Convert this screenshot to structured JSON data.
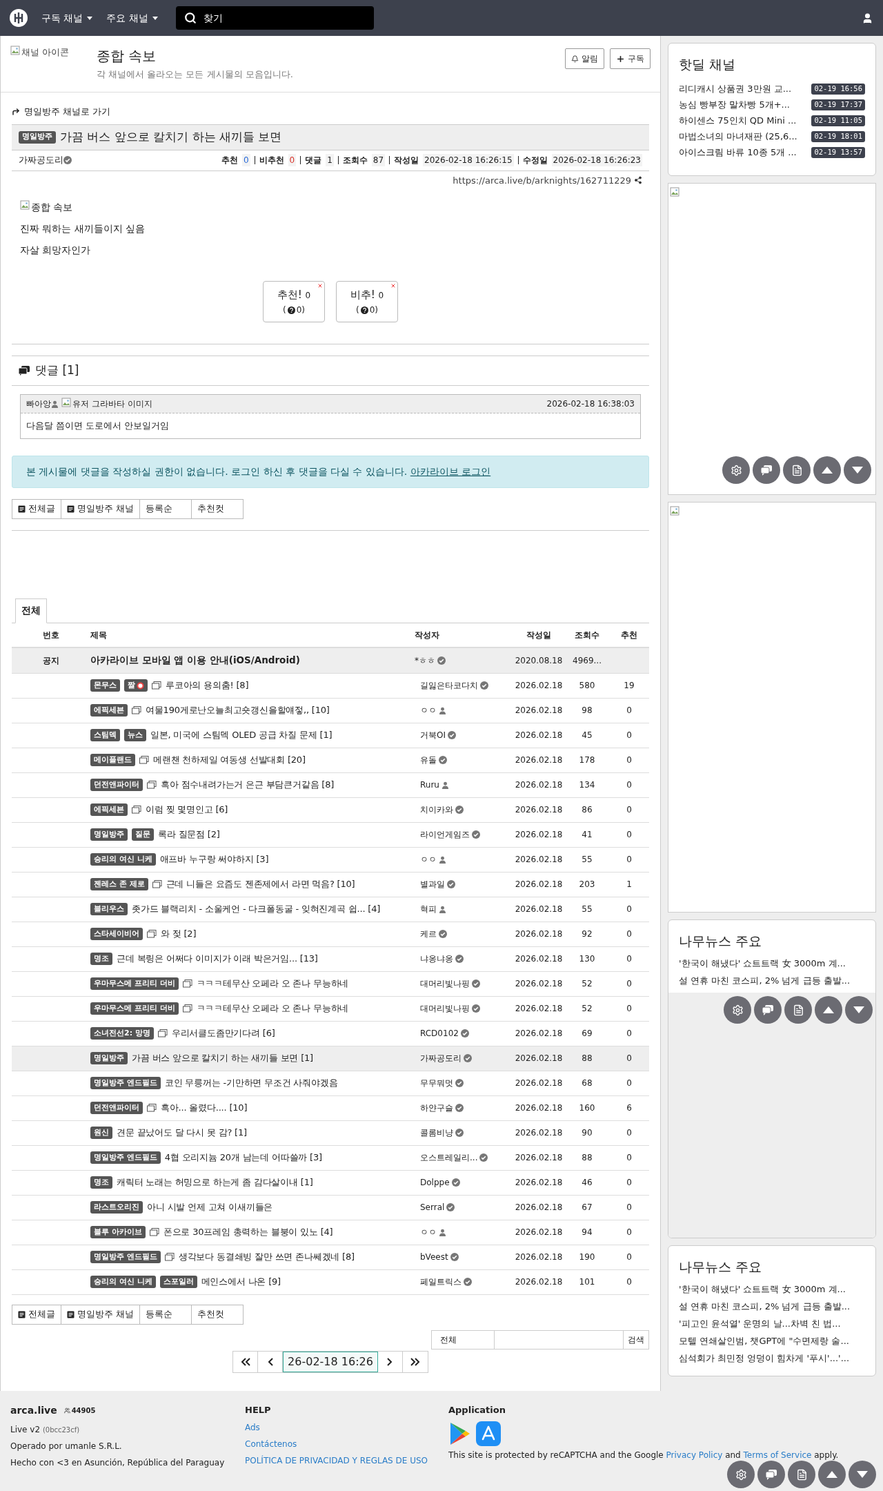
{
  "header": {
    "menus": [
      {
        "label": "구독 채널"
      },
      {
        "label": "주요 채널"
      }
    ],
    "search": {
      "placeholder": "찾기"
    }
  },
  "channel": {
    "icon_alt": "채널 아이콘",
    "title": "종합 속보",
    "description": "각 채널에서 올라오는 모든 게시물의 모음입니다.",
    "buttons": [
      {
        "label": "알림",
        "kind": "bell"
      },
      {
        "label": "구독",
        "kind": "plus"
      }
    ]
  },
  "post": {
    "back_link": "명일방주 채널로 가기",
    "category": "명일방주",
    "title": "가끔 버스 앞으로 칼치기 하는 새끼들 보면",
    "author": "가짜공도리",
    "stats": [
      {
        "label": "추천",
        "value": "0",
        "color": "#2a6bd8"
      },
      {
        "label": "비추천",
        "value": "0",
        "color": "#d9342b"
      },
      {
        "label": "댓글",
        "value": "1",
        "color": "#222222"
      },
      {
        "label": "조회수",
        "value": "87",
        "color": "#222222"
      },
      {
        "label": "작성일",
        "value": "2026-02-18 16:26:15",
        "color": "#222222"
      },
      {
        "label": "수정일",
        "value": "2026-02-18 16:26:23",
        "color": "#222222"
      }
    ],
    "url": "https://arca.live/b/arknights/162711229",
    "image_alt": "종합 속보",
    "body": [
      "진짜 뭐하는 새끼들이지 싶음",
      "자살 희망자인가"
    ],
    "votes": [
      {
        "label": "추천!",
        "count": "0",
        "sub": "0)",
        "open": "("
      },
      {
        "label": "비추!",
        "count": "0",
        "sub": "0)",
        "open": "("
      }
    ]
  },
  "comments": {
    "title": "댓글 [1]",
    "items": [
      {
        "author": "빠아앙",
        "avatar_alt": "유저 그라바타 이미지",
        "time": "2026-02-18 16:38:03",
        "text": "다음달 쯤이면 도로에서 안보일거임"
      }
    ]
  },
  "login_notice": {
    "text": "본 게시물에 댓글을 작성하실 권한이 없습니다. 로그인 하신 후 댓글을 다실 수 있습니다.",
    "link": "아카라이브 로그인"
  },
  "list_buttons_top": [
    {
      "label": "전체글",
      "icon": true
    },
    {
      "label": "명일방주 채널",
      "icon": true
    },
    {
      "label": "등록순",
      "icon": false
    },
    {
      "label": "추천컷",
      "icon": false
    }
  ],
  "board_tabs": [
    {
      "label": "전체",
      "selected": true
    }
  ],
  "table": {
    "columns": [
      "번호",
      "제목",
      "작성자",
      "작성일",
      "조회수",
      "추천"
    ],
    "notice": {
      "number": "공지",
      "title": "아카라이브 모바일 앱 이용 안내(iOS/Android)",
      "author": "*ㅎㅎ",
      "verified": true,
      "date": "2020.08.18",
      "views": "4969..."
    },
    "rows": [
      {
        "badges": [
          {
            "label": "몬무스",
            "adult": false
          },
          {
            "label": "짤",
            "adult": true
          }
        ],
        "image": true,
        "title": "루코아의 용의춤! [8]",
        "author": "길잃은타코다치",
        "verified": true,
        "date": "2026.02.18",
        "views": "580",
        "votes": "19",
        "selected": false
      },
      {
        "badges": [
          {
            "label": "에픽세븐",
            "adult": false
          }
        ],
        "image": true,
        "title": "여물190게로난오늘최고숏갱신을할얘젛,, [10]",
        "author": "ㅇㅇ",
        "verified": false,
        "date": "2026.02.18",
        "views": "98",
        "votes": "0",
        "selected": false
      },
      {
        "badges": [
          {
            "label": "스팀덱",
            "adult": false
          },
          {
            "label": "뉴스",
            "adult": false
          }
        ],
        "image": false,
        "title": "일본, 미국에 스팀덱 OLED 공급 차질 문제 [1]",
        "author": "거북OI",
        "verified": true,
        "date": "2026.02.18",
        "views": "45",
        "votes": "0",
        "selected": false
      },
      {
        "badges": [
          {
            "label": "메이플랜드",
            "adult": false
          }
        ],
        "image": true,
        "title": "메랜챈 천하제일 여동생 선발대회 [20]",
        "author": "유돌",
        "verified": true,
        "date": "2026.02.18",
        "views": "178",
        "votes": "0",
        "selected": false
      },
      {
        "badges": [
          {
            "label": "던전앤파이터",
            "adult": false
          }
        ],
        "image": true,
        "title": "흑아 점수내려가는거 은근 부담큰거같음 [8]",
        "author": "Ruru",
        "verified": false,
        "date": "2026.02.18",
        "views": "134",
        "votes": "0",
        "selected": false
      },
      {
        "badges": [
          {
            "label": "에픽세븐",
            "adult": false
          }
        ],
        "image": true,
        "title": "이럼 찢 몇명인고 [6]",
        "author": "치이카와",
        "verified": true,
        "date": "2026.02.18",
        "views": "86",
        "votes": "0",
        "selected": false
      },
      {
        "badges": [
          {
            "label": "명일방주",
            "adult": false
          },
          {
            "label": "질문",
            "adult": false
          }
        ],
        "image": false,
        "title": "록라 질문점 [2]",
        "author": "라이언게임즈",
        "verified": true,
        "date": "2026.02.18",
        "views": "41",
        "votes": "0",
        "selected": false
      },
      {
        "badges": [
          {
            "label": "승리의 여신 니케",
            "adult": false
          }
        ],
        "image": false,
        "title": "애프바 누구랑 써야하지 [3]",
        "author": "ㅇㅇ",
        "verified": false,
        "date": "2026.02.18",
        "views": "55",
        "votes": "0",
        "selected": false
      },
      {
        "badges": [
          {
            "label": "젠레스 존 제로",
            "adult": false
          }
        ],
        "image": true,
        "title": "근데 니들은 요즘도 젠존제에서 라면 먹음? [10]",
        "author": "별과일",
        "verified": true,
        "date": "2026.02.18",
        "views": "203",
        "votes": "1",
        "selected": false
      },
      {
        "badges": [
          {
            "label": "블리우스",
            "adult": false
          }
        ],
        "image": false,
        "title": "좃가드 블랙리치 - 소울케언 - 다크폴동굴 - 잊혀진계곡 쉽... [4]",
        "author": "혁피",
        "verified": false,
        "date": "2026.02.18",
        "views": "55",
        "votes": "0",
        "selected": false
      },
      {
        "badges": [
          {
            "label": "스타세이비어",
            "adult": false
          }
        ],
        "image": true,
        "title": "와 젖 [2]",
        "author": "케르",
        "verified": true,
        "date": "2026.02.18",
        "views": "92",
        "votes": "0",
        "selected": false
      },
      {
        "badges": [
          {
            "label": "명조",
            "adult": false
          }
        ],
        "image": false,
        "title": "근데 복링은 어쩌다 이미지가 이래 박은거임... [13]",
        "author": "냐옹냐옹",
        "verified": true,
        "date": "2026.02.18",
        "views": "130",
        "votes": "0",
        "selected": false
      },
      {
        "badges": [
          {
            "label": "우마무스메 프리티 더비",
            "adult": false
          }
        ],
        "image": true,
        "title": "ㅋㅋㅋ테무산 오페라 오 존나 무능하네",
        "author": "대머리빛나핑",
        "verified": true,
        "date": "2026.02.18",
        "views": "52",
        "votes": "0",
        "selected": false
      },
      {
        "badges": [
          {
            "label": "우마무스메 프리티 더비",
            "adult": false
          }
        ],
        "image": true,
        "title": "ㅋㅋㅋ테무산 오페라 오 존나 무능하네",
        "author": "대머리빛나핑",
        "verified": true,
        "date": "2026.02.18",
        "views": "52",
        "votes": "0",
        "selected": false
      },
      {
        "badges": [
          {
            "label": "소녀전선2: 망명",
            "adult": false
          }
        ],
        "image": true,
        "title": "우리서클도좀만기다려 [6]",
        "author": "RCD0102",
        "verified": true,
        "date": "2026.02.18",
        "views": "69",
        "votes": "0",
        "selected": false
      },
      {
        "badges": [
          {
            "label": "명일방주",
            "adult": false
          }
        ],
        "image": false,
        "title": "가끔 버스 앞으로 칼치기 하는 새끼들 보면 [1]",
        "author": "가짜공도리",
        "verified": true,
        "date": "2026.02.18",
        "views": "88",
        "votes": "0",
        "selected": true
      },
      {
        "badges": [
          {
            "label": "명일방주 엔드필드",
            "adult": false
          }
        ],
        "image": false,
        "title": "코인 무릉꺼는 -기만하면 무조건 사줘야겠음",
        "author": "무무뭐멋",
        "verified": true,
        "date": "2026.02.18",
        "views": "68",
        "votes": "0",
        "selected": false
      },
      {
        "badges": [
          {
            "label": "던전앤파이터",
            "adult": false
          }
        ],
        "image": true,
        "title": "흑아... 올렸다.... [10]",
        "author": "하얀구슬",
        "verified": true,
        "date": "2026.02.18",
        "views": "160",
        "votes": "6",
        "selected": false
      },
      {
        "badges": [
          {
            "label": "원신",
            "adult": false
          }
        ],
        "image": false,
        "title": "견문 끝났어도 달 다시 못 감? [1]",
        "author": "콜롬비냥",
        "verified": true,
        "date": "2026.02.18",
        "views": "90",
        "votes": "0",
        "selected": false
      },
      {
        "badges": [
          {
            "label": "명일방주 엔드필드",
            "adult": false
          }
        ],
        "image": false,
        "title": "4협 오리지늄 20개 남는데 어따쓸까 [3]",
        "author": "오스트레일리...",
        "verified": true,
        "date": "2026.02.18",
        "views": "88",
        "votes": "0",
        "selected": false
      },
      {
        "badges": [
          {
            "label": "명조",
            "adult": false
          }
        ],
        "image": false,
        "title": "캐릭터 노래는 허밍으로 하는게 좀 감다살이내 [1]",
        "author": "Dolppe",
        "verified": true,
        "date": "2026.02.18",
        "views": "46",
        "votes": "0",
        "selected": false
      },
      {
        "badges": [
          {
            "label": "라스트오리진",
            "adult": false
          }
        ],
        "image": false,
        "title": "아니 시발 언제 고쳐 이새끼들은",
        "author": "Serral",
        "verified": true,
        "date": "2026.02.18",
        "views": "67",
        "votes": "0",
        "selected": false
      },
      {
        "badges": [
          {
            "label": "블루 아카이브",
            "adult": false
          }
        ],
        "image": true,
        "title": "폰으로 30프레임 총력하는 블붕이 있노 [4]",
        "author": "ㅇㅇ",
        "verified": false,
        "date": "2026.02.18",
        "views": "94",
        "votes": "0",
        "selected": false
      },
      {
        "badges": [
          {
            "label": "명일방주 엔드필드",
            "adult": false
          }
        ],
        "image": true,
        "title": "생각보다 동결쇄빙 잘만 쓰면 존나쎄겠네 [8]",
        "author": "bVeest",
        "verified": true,
        "date": "2026.02.18",
        "views": "190",
        "votes": "0",
        "selected": false
      },
      {
        "badges": [
          {
            "label": "승리의 여신 니케",
            "adult": false
          },
          {
            "label": "스포일러",
            "adult": false
          }
        ],
        "image": false,
        "title": "메인스에서 나온 [9]",
        "author": "페일트릭스",
        "verified": true,
        "date": "2026.02.18",
        "views": "101",
        "votes": "0",
        "selected": false
      }
    ]
  },
  "list_buttons_bottom": [
    {
      "label": "전체글",
      "icon": true
    },
    {
      "label": "명일방주 채널",
      "icon": true
    },
    {
      "label": "등록순",
      "icon": false
    },
    {
      "label": "추천컷",
      "icon": false
    }
  ],
  "search": {
    "scope": "전체",
    "button": "검색"
  },
  "pagination": {
    "current": "26-02-18 16:26"
  },
  "sidebar": {
    "hot_deals": {
      "title": "핫딜 채널",
      "items": [
        {
          "title": "리디캐시 상품권 3만원 교...",
          "time": "02-19 16:56"
        },
        {
          "title": "농심 빵부장 말차빵 5개+...",
          "time": "02-19 17:37"
        },
        {
          "title": "하이센스 75인치 QD Mini ...",
          "time": "02-19 11:05"
        },
        {
          "title": "마법소녀의 마녀재판 (25,6...",
          "time": "02-19 18:01"
        },
        {
          "title": "아이스크림 바류 10종 5개 ...",
          "time": "02-19 13:57"
        }
      ]
    },
    "news": [
      {
        "title": "나무뉴스 주요",
        "items": [
          "'한국이 해냈다' 쇼트트랙 女 3000m 계...",
          "설 연휴 마친 코스피, 2% 넘게 급등 출발..."
        ]
      },
      {
        "title": "나무뉴스 주요",
        "items": [
          "'한국이 해냈다' 쇼트트랙 女 3000m 계...",
          "설 연휴 마친 코스피, 2% 넘게 급등 출발...",
          "'피고인 윤석열' 운명의 날...차벽 친 법...",
          "모텔 연쇄살인범, 챗GPT에 \"수면제랑 술...",
          "심석회가 최민정 엉덩이 힘차게 '푸시'...'..."
        ]
      }
    ]
  },
  "footer": {
    "site": "arca.live",
    "users": "44905",
    "version": "Live v2",
    "build": "(0bcc23cf)",
    "operator": "Operado por umanle S.R.L.",
    "made": "Hecho con <3 en Asunción, República del Paraguay",
    "help_title": "HELP",
    "help_links": [
      "Ads",
      "Contáctenos",
      "POLÍTICA DE PRIVACIDAD Y REGLAS DE USO"
    ],
    "app_title": "Application",
    "recaptcha": [
      "This site is protected by reCAPTCHA and the Google ",
      "Privacy Policy",
      " and ",
      "Terms of Service",
      " apply."
    ]
  }
}
